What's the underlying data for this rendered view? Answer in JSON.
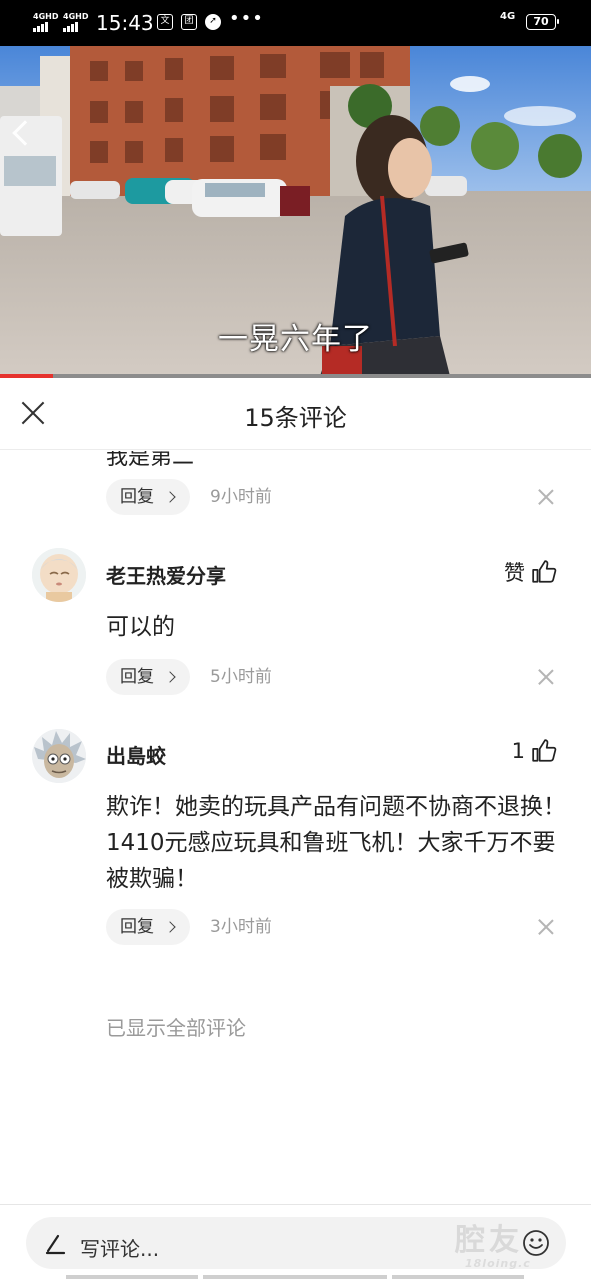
{
  "status_bar": {
    "sim1": "4GHD",
    "sim2": "4GHD",
    "time": "15:43",
    "network": "4G",
    "battery": "70",
    "notif_icons": [
      "text-icon",
      "group-icon",
      "compass-icon"
    ]
  },
  "video": {
    "subtitle": "一晃六年了",
    "progress_percent": 9
  },
  "sheet": {
    "title": "15条评论"
  },
  "comments": {
    "partial": {
      "text": "我是第二",
      "reply_label": "回复",
      "time": "9小时前"
    },
    "items": [
      {
        "username": "老王热爱分享",
        "like_label": "赞",
        "text": "可以的",
        "reply_label": "回复",
        "time": "5小时前"
      },
      {
        "username": "出島蛟",
        "like_label": "1",
        "text": "欺诈！她卖的玩具产品有问题不协商不退换！1410元感应玩具和鲁班飞机！大家千万不要被欺骗！",
        "reply_label": "回复",
        "time": "3小时前"
      }
    ],
    "footer": "已显示全部评论"
  },
  "composer": {
    "placeholder": "写评论..."
  },
  "colors": {
    "progress_accent": "#e6322d",
    "status_bar_bg": "#000000",
    "reply_pill_bg": "#f3f3f3",
    "muted_text": "#9a9a9a"
  }
}
